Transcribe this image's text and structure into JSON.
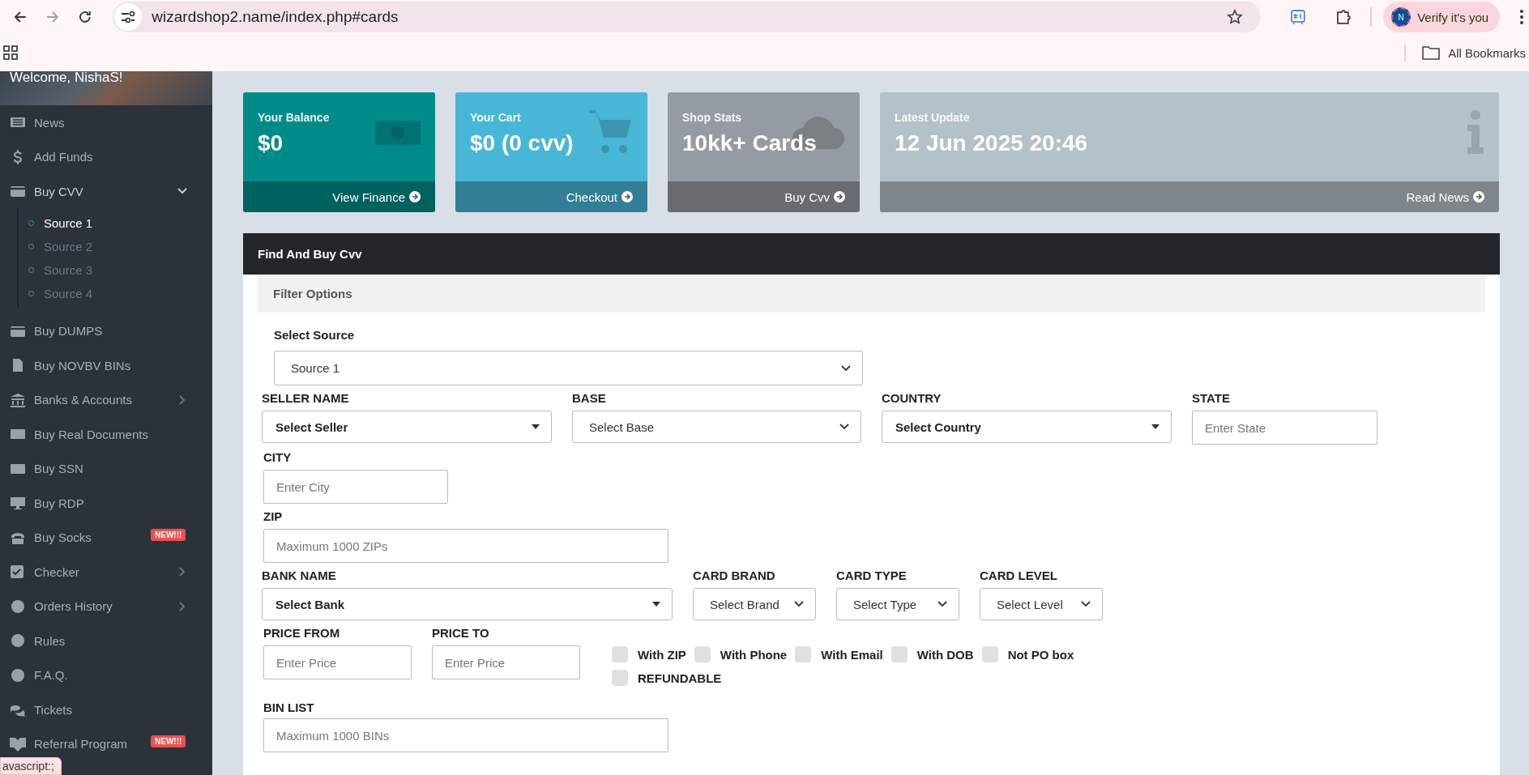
{
  "browser": {
    "url": "wizardshop2.name/index.php#cards",
    "forward_disabled": true,
    "profile_initial": "N",
    "profile_label": "Verify it's you",
    "bookmarks_label": "All Bookmarks",
    "status_text": "avascript:;"
  },
  "sidebar": {
    "welcome": "Welcome, NishaS!",
    "items": [
      {
        "label": "News"
      },
      {
        "label": "Add Funds"
      },
      {
        "label": "Buy CVV",
        "expanded": true,
        "children": [
          {
            "label": "Source 1",
            "selected": true
          },
          {
            "label": "Source 2",
            "selected": false
          },
          {
            "label": "Source 3",
            "selected": false
          },
          {
            "label": "Source 4",
            "selected": false
          }
        ]
      },
      {
        "label": "Buy DUMPS"
      },
      {
        "label": "Buy NOVBV BINs"
      },
      {
        "label": "Banks & Accounts",
        "expanded": false
      },
      {
        "label": "Buy Real Documents"
      },
      {
        "label": "Buy SSN"
      },
      {
        "label": "Buy RDP"
      },
      {
        "label": "Buy Socks",
        "badge": "NEW!!!"
      },
      {
        "label": "Checker",
        "expanded": false
      },
      {
        "label": "Orders History",
        "expanded": false
      },
      {
        "label": "Rules"
      },
      {
        "label": "F.A.Q."
      },
      {
        "label": "Tickets"
      },
      {
        "label": "Referral Program",
        "badge": "NEW!!!"
      }
    ]
  },
  "stat_cards": [
    {
      "title": "Your Balance",
      "value": "$0",
      "link": "View Finance",
      "color": "#008b8b"
    },
    {
      "title": "Your Cart",
      "value": "$0 (0 cvv)",
      "link": "Checkout",
      "color": "#48b6d6"
    },
    {
      "title": "Shop Stats",
      "value": "10kk+ Cards",
      "link": "Buy Cvv",
      "color": "#959ba2"
    },
    {
      "title": "Latest Update",
      "value": "12 Jun 2025 20:46",
      "link": "Read News",
      "color": "#b5c1c8"
    }
  ],
  "panel": {
    "title": "Find And Buy Cvv",
    "filter_title": "Filter Options",
    "source": {
      "label": "Select Source",
      "value": "Source 1"
    },
    "rows": [
      [
        {
          "label": "SELLER NAME",
          "kind": "combobox",
          "value": "Select Seller"
        },
        {
          "label": "BASE",
          "kind": "select",
          "value": "Select Base"
        },
        {
          "label": "COUNTRY",
          "kind": "combobox",
          "value": "Select Country"
        },
        {
          "label": "STATE",
          "kind": "input",
          "placeholder": "Enter State"
        }
      ],
      [
        {
          "label": "CITY",
          "kind": "input",
          "placeholder": "Enter City"
        }
      ],
      [
        {
          "label": "ZIP",
          "kind": "input",
          "placeholder": "Maximum 1000 ZIPs"
        }
      ],
      [
        {
          "label": "BANK NAME",
          "kind": "combobox",
          "value": "Select Bank"
        },
        {
          "label": "CARD BRAND",
          "kind": "select",
          "value": "Select Brand"
        },
        {
          "label": "CARD TYPE",
          "kind": "select",
          "value": "Select Type"
        },
        {
          "label": "CARD LEVEL",
          "kind": "select",
          "value": "Select Level"
        }
      ]
    ],
    "price_fields": [
      {
        "label": "PRICE FROM",
        "placeholder": "Enter Price"
      },
      {
        "label": "PRICE TO",
        "placeholder": "Enter Price"
      }
    ],
    "options": [
      {
        "label": "With ZIP",
        "checked": false
      },
      {
        "label": "With Phone",
        "checked": false
      },
      {
        "label": "With Email",
        "checked": false
      },
      {
        "label": "With DOB",
        "checked": false
      },
      {
        "label": "Not PO box",
        "checked": false
      },
      {
        "label": "REFUNDABLE",
        "checked": false
      }
    ],
    "bin_field": {
      "label": "BIN LIST",
      "placeholder": "Maximum 1000 BINs"
    }
  }
}
